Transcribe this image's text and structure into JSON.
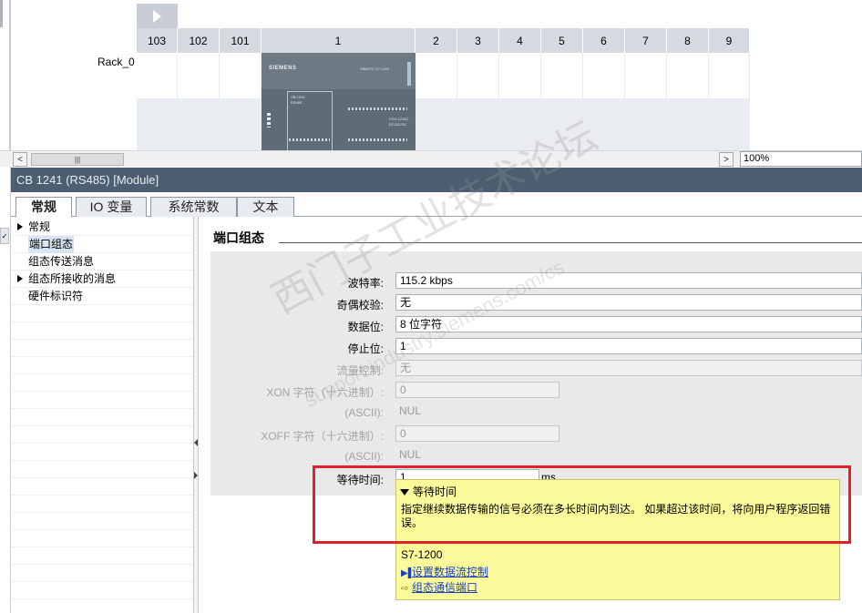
{
  "rack": {
    "label": "Rack_0",
    "slots": [
      "103",
      "102",
      "101",
      "1",
      "2",
      "3",
      "4",
      "5",
      "6",
      "7",
      "8",
      "9"
    ],
    "cpu_brand": "SIEMENS",
    "cpu_model_text": "SIMATIC S7-1200",
    "cb_text": "CB 1241\nRS485",
    "cpu_label": "CPU 1214C\nDC/DC/DC"
  },
  "scrollbar": {
    "thumb_label": "|||",
    "left_arrow": "<",
    "right_arrow": ">"
  },
  "zoom": "100%",
  "properties": {
    "title": "CB 1241 (RS485) [Module]",
    "tabs": [
      "常规",
      "IO 变量",
      "系统常数",
      "文本"
    ]
  },
  "nav": {
    "items": [
      {
        "label": "常规",
        "arrow": true
      },
      {
        "label": "端口组态",
        "arrow": false,
        "selected": true
      },
      {
        "label": "组态传送消息",
        "arrow": false
      },
      {
        "label": "组态所接收的消息",
        "arrow": true
      },
      {
        "label": "硬件标识符",
        "arrow": false
      }
    ]
  },
  "section": {
    "title": "端口组态"
  },
  "form": {
    "baud_label": "波特率:",
    "baud_value": "115.2 kbps",
    "parity_label": "奇偶校验:",
    "parity_value": "无",
    "databits_label": "数据位:",
    "databits_value": "8 位字符",
    "stopbits_label": "停止位:",
    "stopbits_value": "1",
    "flow_label": "流量控制:",
    "flow_value": "无",
    "xon_label": "XON 字符（十六进制）:",
    "xon_value": "0",
    "xon_ascii_label": "(ASCII):",
    "xon_ascii_value": "NUL",
    "xoff_label": "XOFF 字符（十六进制）:",
    "xoff_value": "0",
    "xoff_ascii_label": "(ASCII):",
    "xoff_ascii_value": "NUL",
    "wait_label": "等待时间:",
    "wait_value": "1",
    "wait_unit": "ms"
  },
  "tooltip": {
    "title": "等待时间",
    "body": "指定继续数据传输的信号必须在多长时间内到达。 如果超过该时间，将向用户程序返回错误。",
    "product": "S7-1200",
    "link1": "设置数据流控制",
    "link2": "组态通信端口"
  },
  "watermark": {
    "main": "西门子工业技术论坛",
    "sub": "support.industry.siemens.com/cs"
  },
  "colors": {
    "title_bar": "#4c5e70",
    "tooltip_bg": "#fbfa9b",
    "highlight": "#e0202a",
    "link": "#1c3fb9"
  }
}
